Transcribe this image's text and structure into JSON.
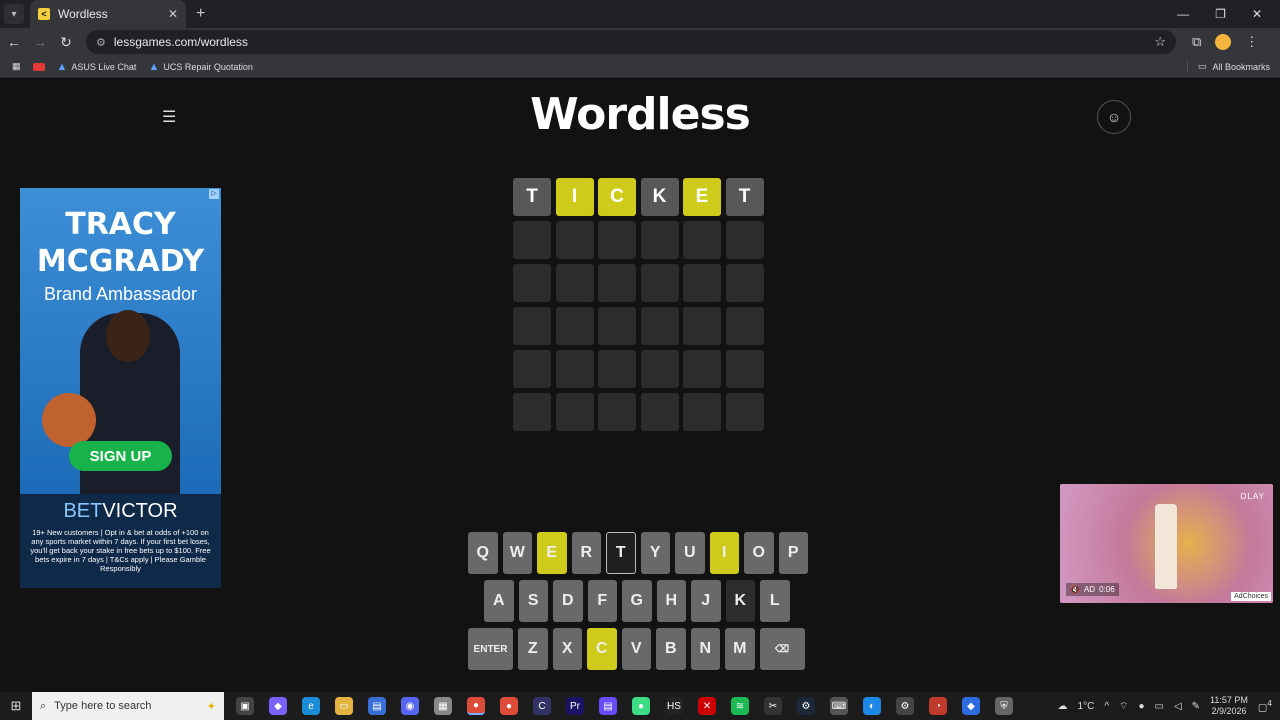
{
  "browser": {
    "tab_title": "Wordless",
    "url": "lessgames.com/wordless",
    "bookmarks": [
      {
        "label": "ASUS Live Chat"
      },
      {
        "label": "UCS Repair Quotation"
      }
    ],
    "all_bookmarks": "All Bookmarks"
  },
  "game": {
    "title": "Wordless",
    "guess_rows": [
      [
        {
          "letter": "T",
          "state": "absent"
        },
        {
          "letter": "I",
          "state": "present"
        },
        {
          "letter": "C",
          "state": "present"
        },
        {
          "letter": "K",
          "state": "absent"
        },
        {
          "letter": "E",
          "state": "present"
        },
        {
          "letter": "T",
          "state": "absent"
        }
      ],
      [
        {
          "letter": "",
          "state": "empty"
        },
        {
          "letter": "",
          "state": "empty"
        },
        {
          "letter": "",
          "state": "empty"
        },
        {
          "letter": "",
          "state": "empty"
        },
        {
          "letter": "",
          "state": "empty"
        },
        {
          "letter": "",
          "state": "empty"
        }
      ],
      [
        {
          "letter": "",
          "state": "empty"
        },
        {
          "letter": "",
          "state": "empty"
        },
        {
          "letter": "",
          "state": "empty"
        },
        {
          "letter": "",
          "state": "empty"
        },
        {
          "letter": "",
          "state": "empty"
        },
        {
          "letter": "",
          "state": "empty"
        }
      ],
      [
        {
          "letter": "",
          "state": "empty"
        },
        {
          "letter": "",
          "state": "empty"
        },
        {
          "letter": "",
          "state": "empty"
        },
        {
          "letter": "",
          "state": "empty"
        },
        {
          "letter": "",
          "state": "empty"
        },
        {
          "letter": "",
          "state": "empty"
        }
      ],
      [
        {
          "letter": "",
          "state": "empty"
        },
        {
          "letter": "",
          "state": "empty"
        },
        {
          "letter": "",
          "state": "empty"
        },
        {
          "letter": "",
          "state": "empty"
        },
        {
          "letter": "",
          "state": "empty"
        },
        {
          "letter": "",
          "state": "empty"
        }
      ],
      [
        {
          "letter": "",
          "state": "empty"
        },
        {
          "letter": "",
          "state": "empty"
        },
        {
          "letter": "",
          "state": "empty"
        },
        {
          "letter": "",
          "state": "empty"
        },
        {
          "letter": "",
          "state": "empty"
        },
        {
          "letter": "",
          "state": "empty"
        }
      ]
    ],
    "keyboard": {
      "row1": [
        {
          "label": "Q",
          "state": "default"
        },
        {
          "label": "W",
          "state": "default"
        },
        {
          "label": "E",
          "state": "present"
        },
        {
          "label": "R",
          "state": "default"
        },
        {
          "label": "T",
          "state": "active"
        },
        {
          "label": "Y",
          "state": "default"
        },
        {
          "label": "U",
          "state": "default"
        },
        {
          "label": "I",
          "state": "present"
        },
        {
          "label": "O",
          "state": "default"
        },
        {
          "label": "P",
          "state": "default"
        }
      ],
      "row2": [
        {
          "label": "A",
          "state": "default"
        },
        {
          "label": "S",
          "state": "default"
        },
        {
          "label": "D",
          "state": "default"
        },
        {
          "label": "F",
          "state": "default"
        },
        {
          "label": "G",
          "state": "default"
        },
        {
          "label": "H",
          "state": "default"
        },
        {
          "label": "J",
          "state": "default"
        },
        {
          "label": "K",
          "state": "dark"
        },
        {
          "label": "L",
          "state": "default"
        }
      ],
      "row3": [
        {
          "label": "ENTER",
          "state": "wide"
        },
        {
          "label": "Z",
          "state": "default"
        },
        {
          "label": "X",
          "state": "default"
        },
        {
          "label": "C",
          "state": "present"
        },
        {
          "label": "V",
          "state": "default"
        },
        {
          "label": "B",
          "state": "default"
        },
        {
          "label": "N",
          "state": "default"
        },
        {
          "label": "M",
          "state": "default"
        },
        {
          "label": "⌫",
          "state": "backspace"
        }
      ]
    },
    "colors": {
      "present": "#cfcb1a",
      "absent": "#585858",
      "empty": "#2a2c2e"
    }
  },
  "ads": {
    "left": {
      "name": "TRACY MCGRADY",
      "role": "Brand Ambassador",
      "cta": "SIGN UP",
      "brand_a": "BET",
      "brand_b": "VICTOR",
      "fine_print": "19+ New customers | Opt in & bet at odds of +100 on any sports market within 7 days. If your first bet loses, you'll get back your stake in free bets up to $100. Free bets expire in 7 days | T&Cs apply | Please Gamble Responsibly"
    },
    "right": {
      "brand": "OLAY",
      "timer": "0:06",
      "ad_label": "AD",
      "adchoices": "AdChoices"
    }
  },
  "taskbar": {
    "search_placeholder": "Type here to search",
    "temperature": "1°C",
    "time": "11:57 PM",
    "date": "2/9/2026",
    "notification_count": "4"
  }
}
